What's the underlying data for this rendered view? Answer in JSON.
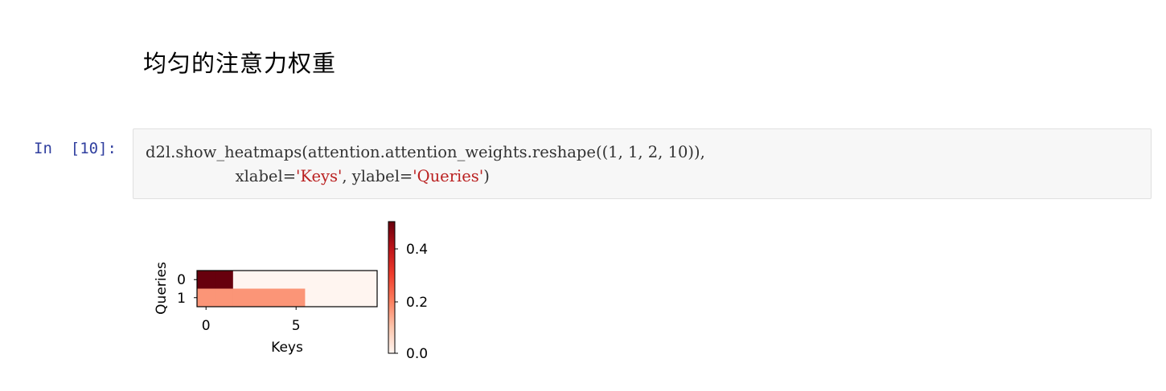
{
  "markdown": {
    "heading": "均匀的注意力权重"
  },
  "cell": {
    "prompt": "In  [10]:",
    "code": {
      "line1": "d2l.show_heatmaps(attention.attention_weights.reshape((1, 1, 2, 10)),",
      "line2_indent": "                  ",
      "line2_a": "xlabel=",
      "line2_b": "'Keys'",
      "line2_c": ", ylabel=",
      "line2_d": "'Queries'",
      "line2_e": ")"
    }
  },
  "colors": {
    "prompt": "#303f9f",
    "string": "#ba2121",
    "cell_bg": "#f7f7f7"
  },
  "chart_data": {
    "type": "heatmap",
    "xlabel": "Keys",
    "ylabel": "Queries",
    "xticks": [
      "0",
      "5"
    ],
    "yticks": [
      "0",
      "1"
    ],
    "matrix": [
      [
        0.5,
        0.5,
        0,
        0,
        0,
        0,
        0,
        0,
        0,
        0
      ],
      [
        0.1667,
        0.1667,
        0.1667,
        0.1667,
        0.1667,
        0.1667,
        0,
        0,
        0,
        0
      ]
    ],
    "colormap": "Reds",
    "colorbar": {
      "ticks": [
        "0.0",
        "0.2",
        "0.4"
      ],
      "range": [
        0,
        0.5
      ]
    }
  }
}
